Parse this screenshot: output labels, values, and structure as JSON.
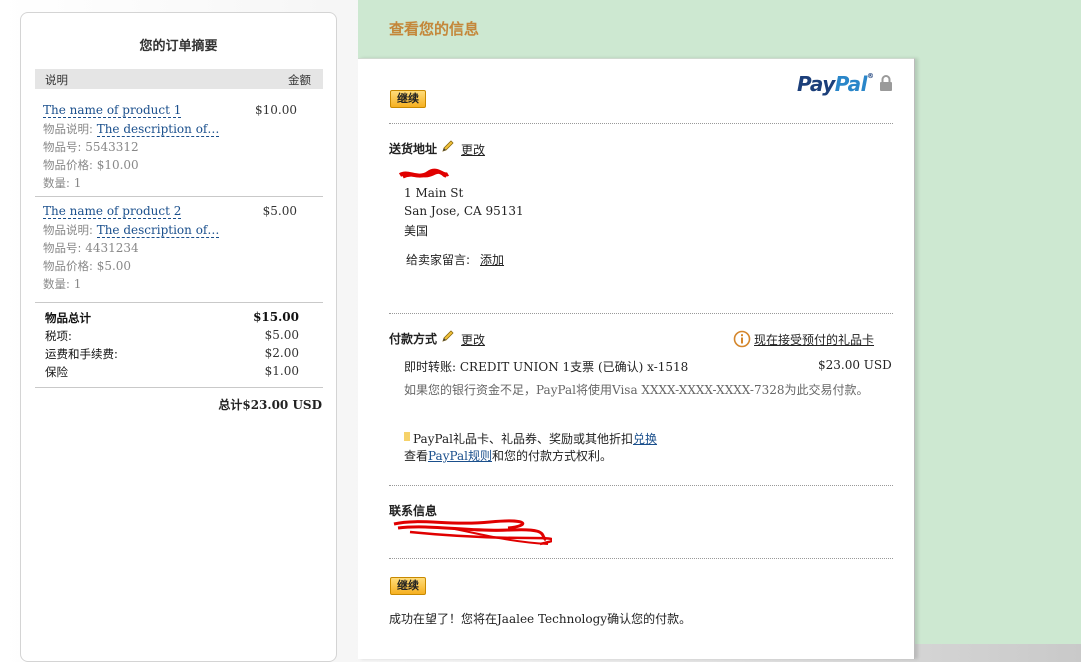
{
  "order_summary": {
    "title": "您的订单摘要",
    "col_description": "说明",
    "col_amount": "金额",
    "items": [
      {
        "name": "The name of product 1",
        "amount": "$10.00",
        "desc_label": "物品说明:",
        "desc_value": "The description of…",
        "number_label": "物品号:",
        "number_value": "5543312",
        "price_label": "物品价格:",
        "price_value": "$10.00",
        "qty_label": "数量:",
        "qty_value": "1"
      },
      {
        "name": "The name of product 2",
        "amount": "$5.00",
        "desc_label": "物品说明:",
        "desc_value": "The description of…",
        "number_label": "物品号:",
        "number_value": "4431234",
        "price_label": "物品价格:",
        "price_value": "$5.00",
        "qty_label": "数量:",
        "qty_value": "1"
      }
    ],
    "totals": [
      {
        "label": "物品总计",
        "value": "$15.00"
      },
      {
        "label": "税项:",
        "value": "$5.00"
      },
      {
        "label": "运费和手续费:",
        "value": "$2.00"
      },
      {
        "label": "保险",
        "value": "$1.00"
      }
    ],
    "grand_total_label": "总计",
    "grand_total_value": "$23.00 USD"
  },
  "review": {
    "title": "查看您的信息",
    "continue_label": "继续",
    "logo_pay": "Pay",
    "logo_pal": "Pal",
    "logo_tm": "®",
    "shipping": {
      "heading": "送货地址",
      "change_label": "更改",
      "address_line1": "1 Main St",
      "address_line2": "San Jose, CA 95131",
      "country": "美国",
      "note_label": "给卖家留言:",
      "note_add": "添加"
    },
    "payment": {
      "heading": "付款方式",
      "change_label": "更改",
      "giftcard_link": "现在接受预付的礼品卡",
      "method_text": "即时转账: CREDIT UNION 1支票 (已确认) x-1518",
      "method_amount": "$23.00 USD",
      "fallback_text": "如果您的银行资金不足，PayPal将使用Visa XXXX-XXXX-XXXX-7328为此交易付款。",
      "redeem_text": "PayPal礼品卡、礼品券、奖励或其他折扣",
      "redeem_link": "兑换",
      "rules_prefix": "查看",
      "rules_link": "PayPal规则",
      "rules_suffix": "和您的付款方式权利。"
    },
    "contact": {
      "heading": "联系信息"
    },
    "footer_text": "成功在望了！您将在Jaalee Technology确认您的付款。"
  },
  "colors": {
    "accent_orange": "#c4873a",
    "link_blue": "#1a4f8c",
    "right_bg": "#cde8d1",
    "button_yellow": "#f6b021"
  }
}
